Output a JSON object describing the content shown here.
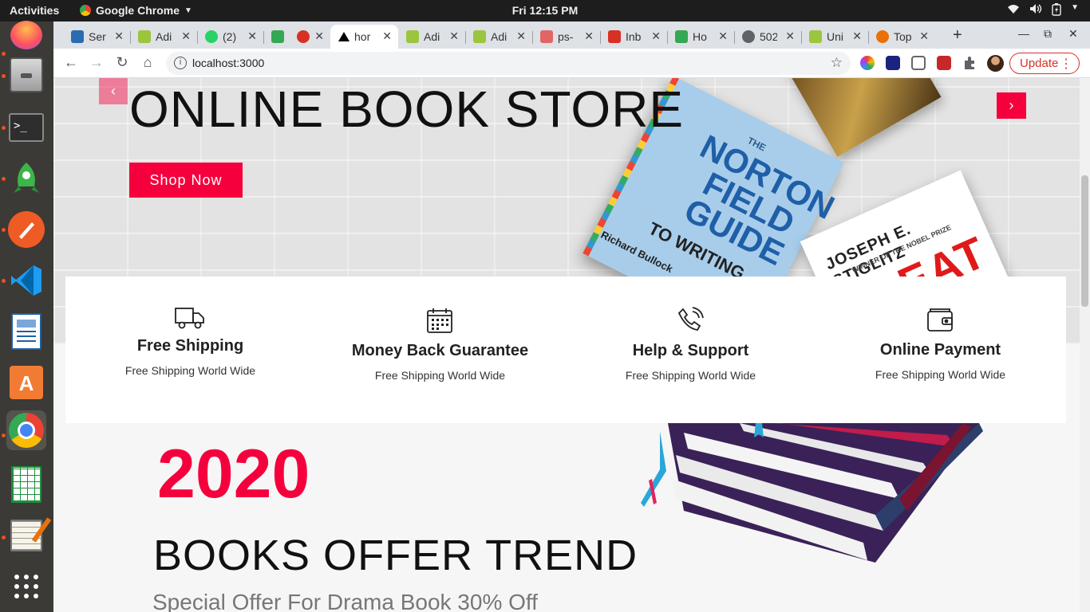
{
  "system_bar": {
    "activities": "Activities",
    "app_name": "Google Chrome",
    "clock": "Fri 12:15 PM"
  },
  "dock": {
    "items": [
      "firefox",
      "files",
      "terminal",
      "rocket-app",
      "postman",
      "vscode",
      "document-viewer",
      "software-center",
      "google-chrome",
      "spreadsheet",
      "text-editor",
      "show-applications"
    ],
    "active": "google-chrome"
  },
  "tabs": [
    {
      "title": "Ser",
      "icon": "envelope-icon",
      "color": "#2b6cb0"
    },
    {
      "title": "Adi",
      "icon": "admin-icon",
      "color": "#9bc53d"
    },
    {
      "title": "(2)",
      "icon": "whatsapp-icon",
      "color": "#25d366"
    },
    {
      "title": "",
      "icon": "meet-icon",
      "color": "#34a853"
    },
    {
      "title": "",
      "icon": "record-icon",
      "color": "#d93025"
    },
    {
      "title": "hor",
      "icon": "vercel-icon",
      "color": "#000000",
      "active": true
    },
    {
      "title": "Adi",
      "icon": "admin-icon",
      "color": "#9bc53d"
    },
    {
      "title": "Adi",
      "icon": "admin-icon",
      "color": "#9bc53d"
    },
    {
      "title": "ps-",
      "icon": "stripes-icon",
      "color": "#e06666"
    },
    {
      "title": "Inb",
      "icon": "gmail-icon",
      "color": "#d93025"
    },
    {
      "title": "Ho",
      "icon": "chart-icon",
      "color": "#34a853"
    },
    {
      "title": "502",
      "icon": "globe-icon",
      "color": "#5f6368"
    },
    {
      "title": "Uni",
      "icon": "admin-icon",
      "color": "#9bc53d"
    },
    {
      "title": "Top",
      "icon": "fire-icon",
      "color": "#e8710a"
    }
  ],
  "address_bar": {
    "url": "localhost:3000"
  },
  "update_button": "Update",
  "hero": {
    "title": "ONLINE BOOK STORE",
    "button": "Shop Now",
    "books": {
      "norton_top": "THE",
      "norton_title": "NORTON FIELD GUIDE",
      "norton_sub": "TO WRITING",
      "norton_author": "Richard Bullock",
      "stiglitz_author": "JOSEPH E. STIGLITZ",
      "stiglitz_prize": "WINNER OF THE NOBEL PRIZE",
      "stiglitz_title": "REAT"
    }
  },
  "features": [
    {
      "title": "Free Shipping",
      "subtitle": "Free Shipping World Wide",
      "icon": "truck-icon"
    },
    {
      "title": "Money Back Guarantee",
      "subtitle": "Free Shipping World Wide",
      "icon": "calendar-icon"
    },
    {
      "title": "Help & Support",
      "subtitle": "Free Shipping World Wide",
      "icon": "phone-icon"
    },
    {
      "title": "Online Payment",
      "subtitle": "Free Shipping World Wide",
      "icon": "wallet-icon"
    }
  ],
  "offer": {
    "year": "2020",
    "title": "BOOKS OFFER TREND",
    "subtitle": "Special Offer For Drama Book 30% Off"
  },
  "colors": {
    "accent": "#f5003c",
    "dock": "#3b3a36",
    "topbar": "#1d1d1d"
  }
}
